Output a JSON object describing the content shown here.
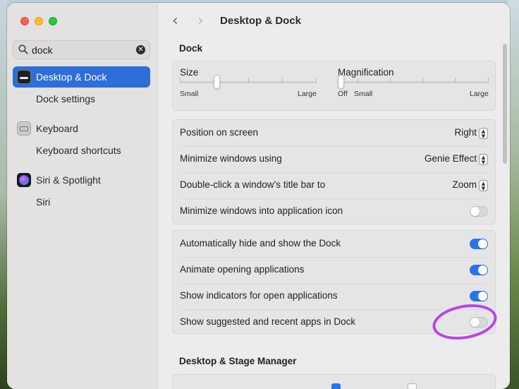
{
  "sidebar": {
    "search_value": "dock",
    "items": [
      {
        "label": "Desktop & Dock",
        "sub": "Dock settings",
        "icon": "desktop-dock-icon",
        "active": true
      },
      {
        "label": "Keyboard",
        "sub": "Keyboard shortcuts",
        "icon": "keyboard-icon",
        "active": false
      },
      {
        "label": "Siri & Spotlight",
        "sub": "Siri",
        "icon": "siri-icon",
        "active": false
      }
    ]
  },
  "toolbar": {
    "title": "Desktop & Dock"
  },
  "dock": {
    "heading": "Dock",
    "size": {
      "label": "Size",
      "min_label": "Small",
      "max_label": "Large",
      "value_fraction": 0.27
    },
    "magnification": {
      "label": "Magnification",
      "off_label": "Off",
      "min_label": "Small",
      "max_label": "Large",
      "value_fraction": 0.0
    },
    "position": {
      "label": "Position on screen",
      "value": "Right"
    },
    "minimize_using": {
      "label": "Minimize windows using",
      "value": "Genie Effect"
    },
    "double_click": {
      "label": "Double-click a window’s title bar to",
      "value": "Zoom"
    },
    "minimize_into_icon": {
      "label": "Minimize windows into application icon",
      "on": false
    },
    "auto_hide": {
      "label": "Automatically hide and show the Dock",
      "on": true
    },
    "animate": {
      "label": "Animate opening applications",
      "on": true
    },
    "indicators": {
      "label": "Show indicators for open applications",
      "on": true
    },
    "suggested": {
      "label": "Show suggested and recent apps in Dock",
      "on": false
    }
  },
  "stage": {
    "heading": "Desktop & Stage Manager"
  },
  "colors": {
    "accent": "#2b74e8",
    "sidebar_selected": "#2d6ed8",
    "annotation": "#b746e5"
  }
}
